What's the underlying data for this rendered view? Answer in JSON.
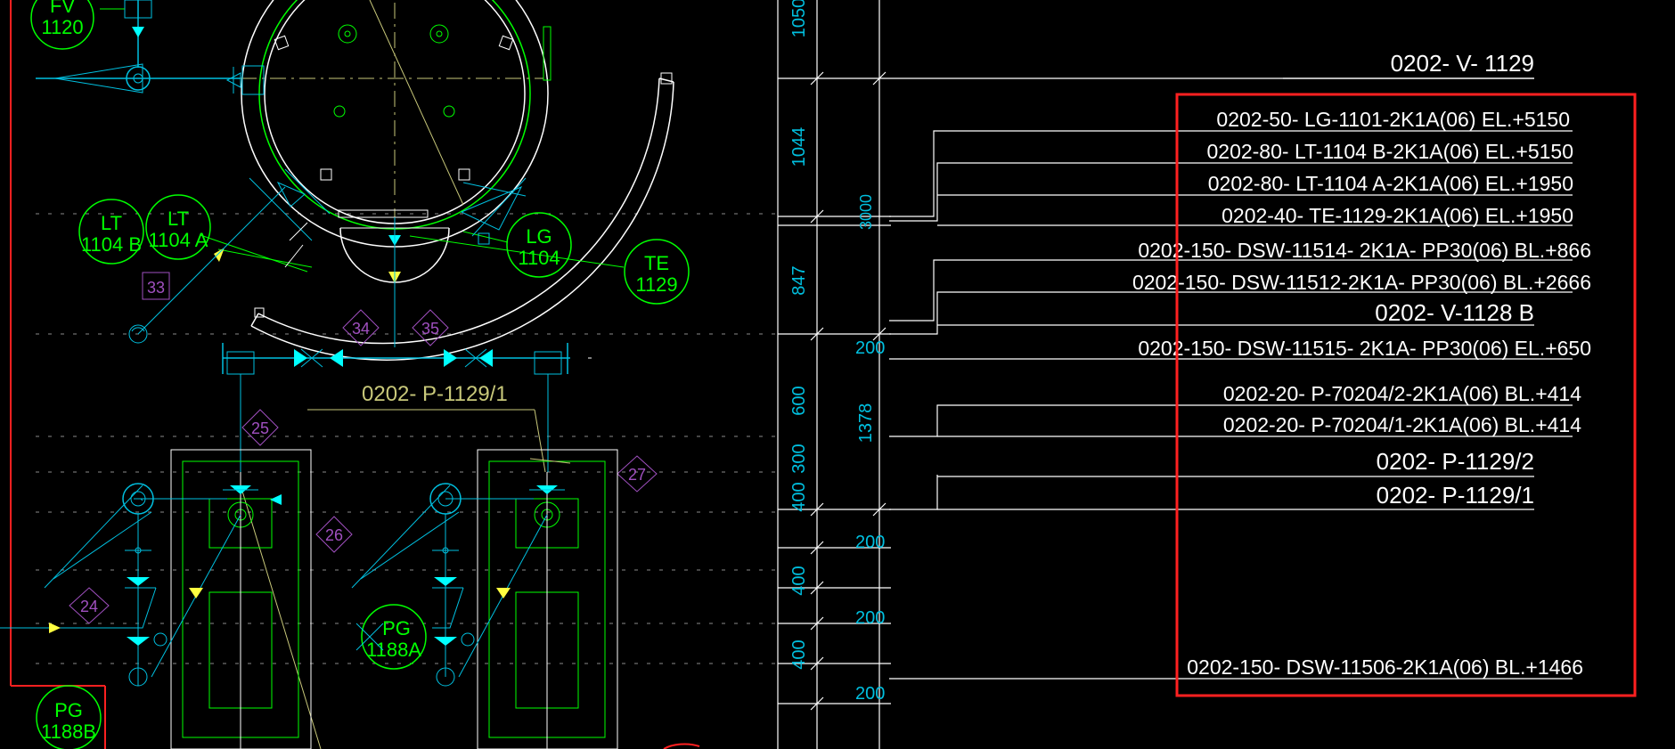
{
  "colors": {
    "background": "#000000",
    "white": "#ffffff",
    "green": "#00ff00",
    "cyan": "#00c0e0",
    "yellow": "#ffff40",
    "olive": "#c8c87a",
    "purple": "#a050c0",
    "red": "#ff2020"
  },
  "instruments": {
    "fv1120": [
      "FV",
      "1120"
    ],
    "lt1104b": [
      "LT",
      "1104 B"
    ],
    "lt1104a": [
      "LT",
      "1104 A"
    ],
    "lg1104": [
      "LG",
      "1104"
    ],
    "te1129": [
      "TE",
      "1129"
    ],
    "pg1188a": [
      "PG",
      "1188A"
    ],
    "pg1188b": [
      "PG",
      "1188B"
    ]
  },
  "markers": {
    "m33": "33",
    "m34": "34",
    "m35": "35",
    "m25": "25",
    "m26": "26",
    "m27": "27",
    "m24": "24"
  },
  "pump_label": "0202- P-1129/1",
  "dimensions": {
    "d1050": "1050",
    "d1044": "1044",
    "d3000": "3000",
    "d847": "847",
    "d200a": "200",
    "d600": "600",
    "d1378": "1378",
    "d300": "300",
    "d400a": "400",
    "d200b": "200",
    "d400b": "400",
    "d200c": "200",
    "d400c": "400",
    "d200d": "200"
  },
  "lines": {
    "l0": "0202- V- 1129",
    "l1": "0202-50- LG-1101-2K1A(06) EL.+5150",
    "l2": "0202-80- LT-1104 B-2K1A(06) EL.+5150",
    "l3": "0202-80- LT-1104 A-2K1A(06) EL.+1950",
    "l4": "0202-40- TE-1129-2K1A(06) EL.+1950",
    "l5": "0202-150- DSW-11514- 2K1A- PP30(06) BL.+866",
    "l6": "0202-150- DSW-11512-2K1A- PP30(06) BL.+2666",
    "l7": "0202- V-1128 B",
    "l8": "0202-150- DSW-11515- 2K1A- PP30(06) EL.+650",
    "l9": "0202-20- P-70204/2-2K1A(06) BL.+414",
    "l10": "0202-20- P-70204/1-2K1A(06) BL.+414",
    "l11": "0202- P-1129/2",
    "l12": "0202- P-1129/1",
    "l13": "0202-150- DSW-11506-2K1A(06) BL.+1466"
  }
}
